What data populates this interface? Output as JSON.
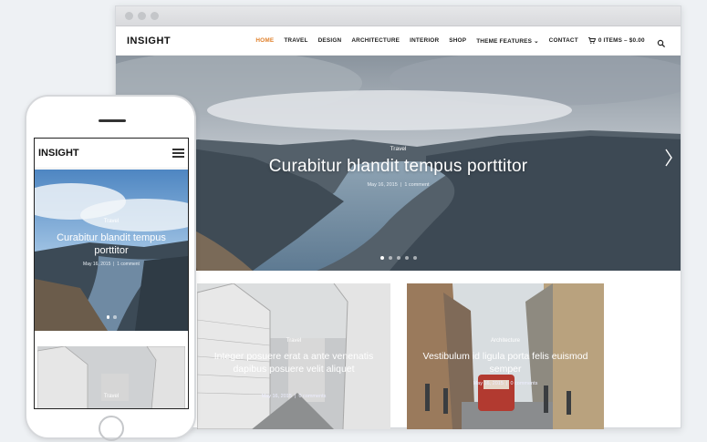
{
  "desktop": {
    "logo": "INSIGHT",
    "nav": [
      "HOME",
      "TRAVEL",
      "DESIGN",
      "ARCHITECTURE",
      "INTERIOR",
      "SHOP",
      "THEME FEATURES ⌄",
      "CONTACT"
    ],
    "cart_label": "0 ITEMS – $0.00",
    "hero": {
      "category": "Travel",
      "title": "Curabitur blandit tempus porttitor",
      "date": "May 16, 2015",
      "comments": "1 comment"
    },
    "cards": [
      {
        "category": "Travel",
        "title": "Integer posuere erat a ante venenatis dapibus posuere velit aliquet",
        "date": "May 16, 2015",
        "comments": "0 comments"
      },
      {
        "category": "Architecture",
        "title": "Vestibulum id ligula porta felis euismod semper",
        "date": "May 16, 2015",
        "comments": "0 comments"
      }
    ]
  },
  "mobile": {
    "logo": "INSIGHT",
    "hero": {
      "category": "Travel",
      "title": "Curabitur blandit tempus porttitor",
      "date": "May 16, 2015",
      "comments": "1 comment"
    },
    "card": {
      "category": "Travel"
    }
  },
  "colors": {
    "accent": "#e0812c",
    "text": "#222222"
  },
  "icons": [
    "cart-icon",
    "search-icon",
    "menu-icon",
    "arrow-right-icon"
  ]
}
